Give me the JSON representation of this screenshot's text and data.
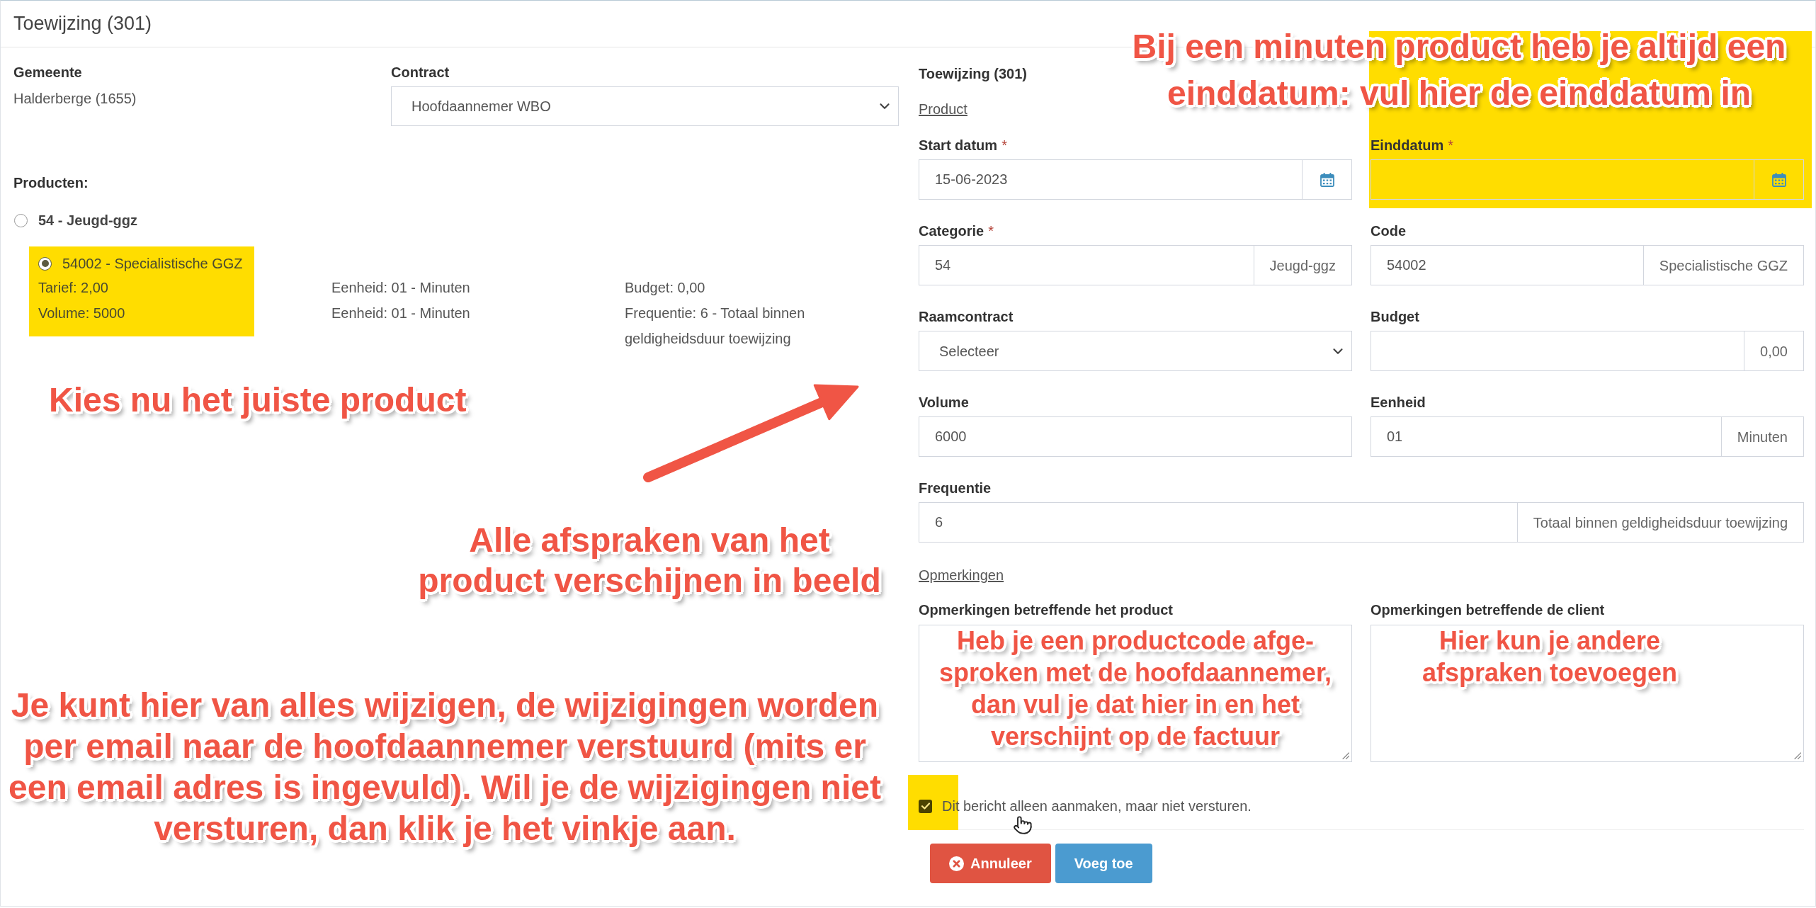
{
  "header": {
    "title": "Toewijzing (301)"
  },
  "municipality": {
    "label": "Gemeente",
    "value": "Halderberge (1655)"
  },
  "contract": {
    "label": "Contract",
    "value": "Hoofdaannemer WBO"
  },
  "products": {
    "heading": "Producten:",
    "items": [
      {
        "label": "54 - Jeugd-ggz",
        "selected": false,
        "children": [
          {
            "label": "54002 - Specialistische GGZ",
            "selected": true,
            "highlighted": true,
            "details": [
              [
                "Tarief: 2,00",
                "Eenheid: 01 - Minuten",
                "Budget: 0,00"
              ],
              [
                "Volume: 5000",
                "Eenheid: 01 - Minuten",
                "Frequentie: 6 - Totaal binnen geldigheidsduur toewijzing"
              ]
            ]
          }
        ]
      }
    ]
  },
  "form": {
    "title": "Toewijzing (301)",
    "section_link": "Product",
    "rows": [
      [
        {
          "kind": "date",
          "label": "Start datum",
          "required_mark": "*",
          "value": "15-06-2023",
          "highlighted": false
        },
        {
          "kind": "date",
          "label": "Einddatum",
          "required_mark": "*",
          "highlighted": true
        }
      ],
      [
        {
          "kind": "addon",
          "label": "Categorie",
          "required_mark": "*",
          "value": "54",
          "addon": "Jeugd-ggz",
          "highlighted": false
        },
        {
          "kind": "addon",
          "label": "Code",
          "value": "54002",
          "addon": "Specialistische GGZ",
          "highlighted": false
        }
      ],
      [
        {
          "kind": "select",
          "label": "Raamcontract",
          "value": "Selecteer",
          "highlighted": false
        },
        {
          "kind": "addon",
          "label": "Budget",
          "addon": "0,00",
          "highlighted": false
        }
      ],
      [
        {
          "kind": "text",
          "label": "Volume",
          "value": "6000",
          "highlighted": false
        },
        {
          "kind": "addon",
          "label": "Eenheid",
          "value": "01",
          "addon": "Minuten",
          "highlighted": false
        }
      ],
      [
        {
          "kind": "addon",
          "label": "Frequentie",
          "value": "6",
          "addon": "Totaal binnen geldigheidsduur toewijzing",
          "highlighted": false
        }
      ]
    ]
  },
  "notes": {
    "link": "Opmerkingen",
    "fields": [
      {
        "label": "Opmerkingen betreffende het product",
        "annotation": "Heb je een productcode afge-\nsproken met de hoofdaannemer,\ndan vul je dat hier in en het\nverschijnt op de factuur"
      },
      {
        "label": "Opmerkingen betreffende de client",
        "annotation": "Hier kun je andere\nafspraken toevoegen"
      }
    ]
  },
  "send_option": {
    "label": "Dit bericht alleen aanmaken, maar niet versturen.",
    "checked": true,
    "highlighted": true
  },
  "buttons": [
    {
      "kind": "danger",
      "label": "Annuleer"
    },
    {
      "kind": "primary",
      "label": "Voeg toe"
    }
  ],
  "annotations": [
    {
      "kind": "callout",
      "text": "Bij een minuten product heb je altijd een\neinddatum: vul hier de einddatum in"
    },
    {
      "kind": "callout",
      "text": "Kies nu het juiste product"
    },
    {
      "kind": "arrow"
    },
    {
      "kind": "callout",
      "text": "Alle afspraken van het\nproduct verschijnen in beeld"
    },
    {
      "kind": "callout",
      "text": "Je kunt hier van alles wijzigen, de wijzigingen worden\nper email naar de hoofdaannemer verstuurd (mits er\neen email adres is ingevuld). Wil je de wijzigingen niet\nversturen, dan klik je het vinkje aan."
    }
  ]
}
